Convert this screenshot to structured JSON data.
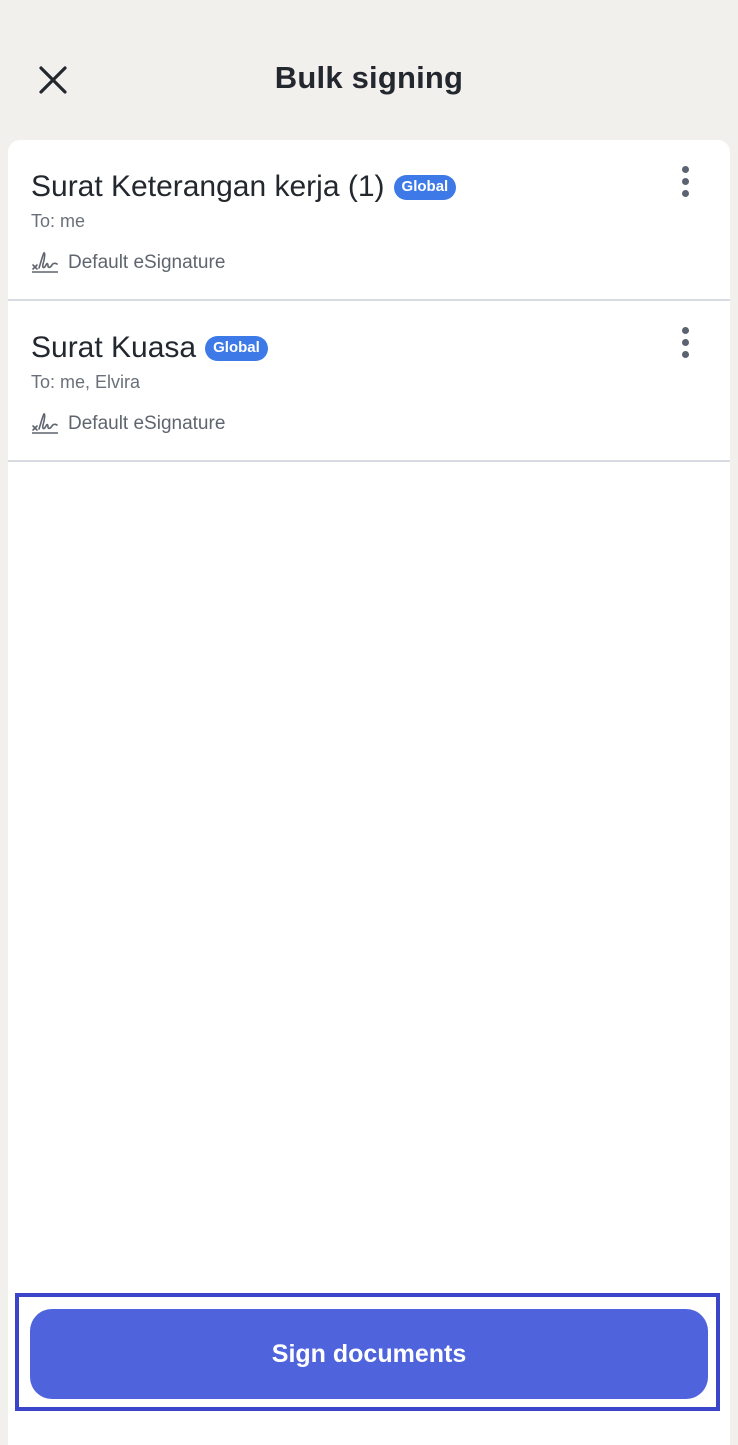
{
  "header": {
    "title": "Bulk signing",
    "close_icon": "close-icon"
  },
  "documents": [
    {
      "title": "Surat Keterangan kerja (1)",
      "badge": "Global",
      "to": "To: me",
      "signature": "Default eSignature"
    },
    {
      "title": "Surat Kuasa",
      "badge": "Global",
      "to": "To: me, Elvira",
      "signature": "Default eSignature"
    }
  ],
  "footer": {
    "sign_label": "Sign documents"
  },
  "colors": {
    "background": "#f2f0ed",
    "accent": "#4f63dc",
    "badge": "#3d7ae8",
    "highlight_frame": "#3a45c9"
  }
}
